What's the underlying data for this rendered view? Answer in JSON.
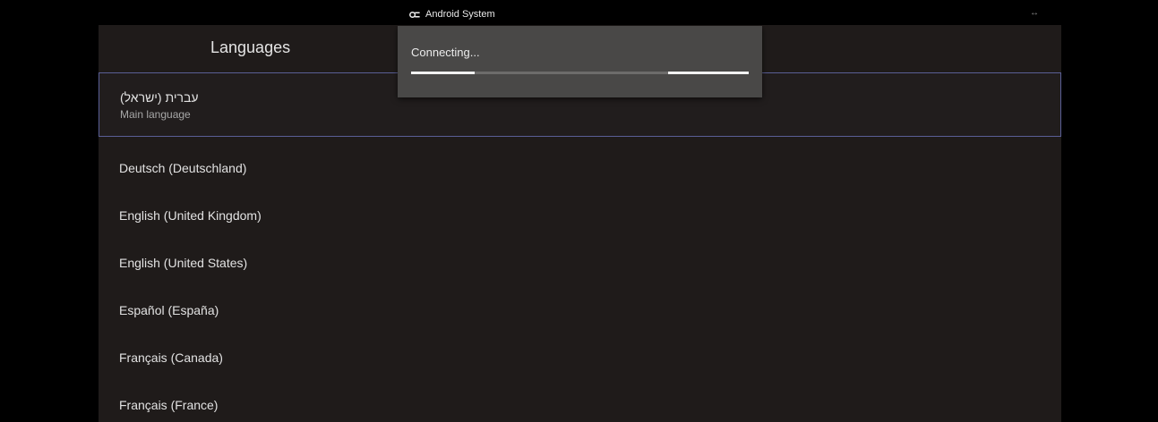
{
  "status_bar": {
    "app_name": "Android System",
    "app_icon": "link-icon",
    "right_icon": "↔"
  },
  "settings": {
    "title": "Languages",
    "languages": [
      {
        "name": "עברית (ישראל)",
        "subtitle": "Main language",
        "selected": true
      },
      {
        "name": "Deutsch (Deutschland)"
      },
      {
        "name": "English (United Kingdom)"
      },
      {
        "name": "English (United States)"
      },
      {
        "name": "Español (España)"
      },
      {
        "name": "Français (Canada)"
      },
      {
        "name": "Français (France)"
      }
    ]
  },
  "dialog": {
    "message": "Connecting...",
    "progress_style": "indeterminate"
  },
  "colors": {
    "background": "#000000",
    "panel": "#1f1b1a",
    "dialog": "#494847",
    "focus_border": "#5a5f96",
    "text_primary": "#e2e2e2",
    "text_secondary": "#a7a7a7"
  }
}
